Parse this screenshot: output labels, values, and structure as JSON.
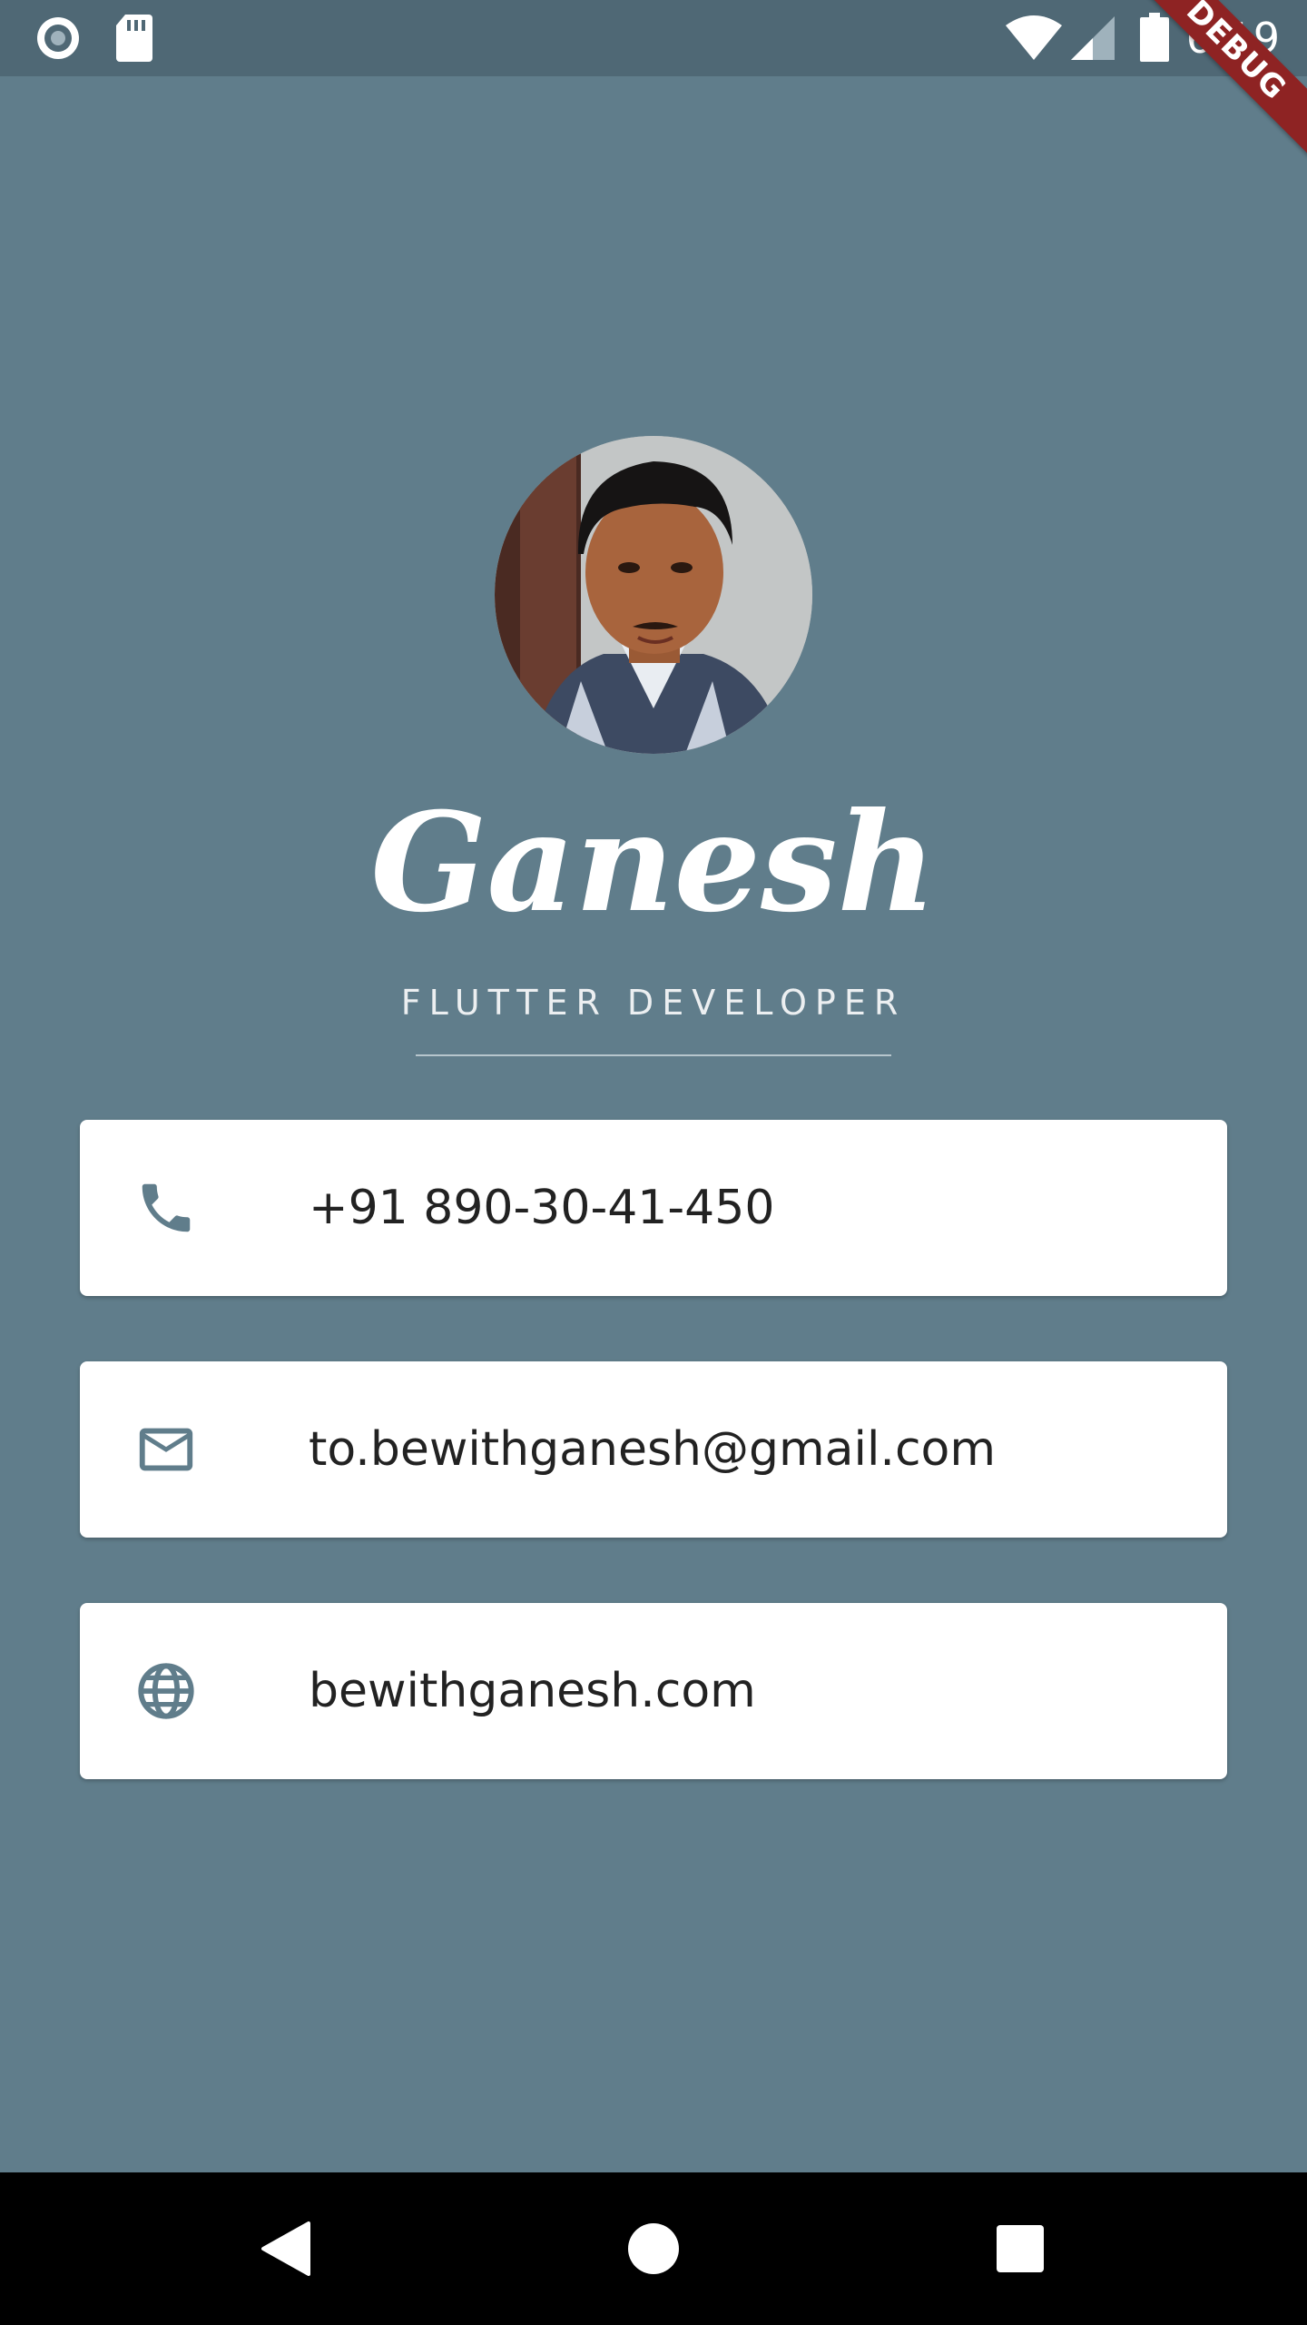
{
  "status_bar": {
    "time": "6:19",
    "icons": [
      "record-icon",
      "sd-card-icon",
      "wifi-icon",
      "signal-icon",
      "battery-icon"
    ]
  },
  "debug_banner": {
    "label": "DEBUG"
  },
  "profile": {
    "name": "Ganesh",
    "role": "FLUTTER DEVELOPER"
  },
  "contacts": [
    {
      "icon": "phone-icon",
      "text": "+91 890-30-41-450"
    },
    {
      "icon": "mail-icon",
      "text": "to.bewithganesh@gmail.com"
    },
    {
      "icon": "globe-icon",
      "text": "bewithganesh.com"
    }
  ],
  "nav_bar": {
    "icons": [
      "back-icon",
      "home-icon",
      "recents-icon"
    ]
  },
  "colors": {
    "background": "#607d8b",
    "status_bar": "#4f6875",
    "card": "#ffffff",
    "icon": "#607d8b",
    "debug_banner": "#8e2323"
  }
}
